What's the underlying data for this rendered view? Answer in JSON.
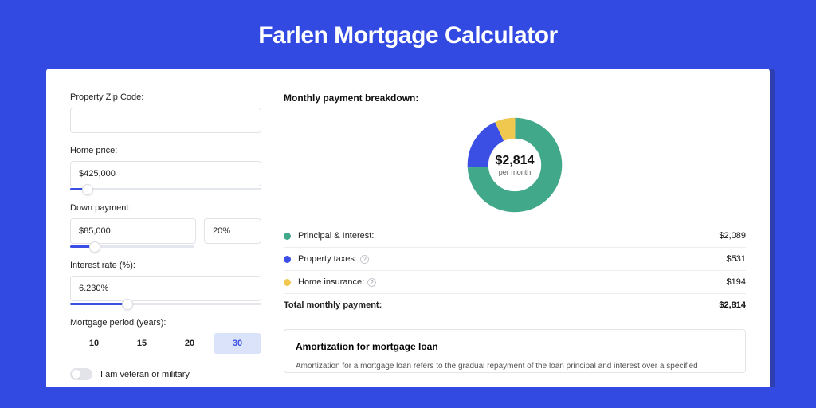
{
  "page_title": "Farlen Mortgage Calculator",
  "form": {
    "zip": {
      "label": "Property Zip Code:",
      "value": ""
    },
    "home_price": {
      "label": "Home price:",
      "value": "$425,000",
      "slider_pct": 9
    },
    "down_payment": {
      "label": "Down payment:",
      "amount": "$85,000",
      "percent": "20%",
      "slider_pct": 20
    },
    "interest_rate": {
      "label": "Interest rate (%):",
      "value": "6.230%",
      "slider_pct": 30
    },
    "period": {
      "label": "Mortgage period (years):",
      "options": [
        "10",
        "15",
        "20",
        "30"
      ],
      "selected": "30"
    },
    "veteran": {
      "label": "I am veteran or military",
      "on": false
    }
  },
  "breakdown": {
    "title": "Monthly payment breakdown:",
    "donut": {
      "amount": "$2,814",
      "sub": "per month"
    },
    "rows": [
      {
        "key": "principal_interest",
        "label": "Principal & Interest:",
        "value": "$2,089",
        "color": "#41a98a",
        "help": false,
        "pct": 74
      },
      {
        "key": "property_taxes",
        "label": "Property taxes:",
        "value": "$531",
        "color": "#3b4fe4",
        "help": true,
        "pct": 19
      },
      {
        "key": "home_insurance",
        "label": "Home insurance:",
        "value": "$194",
        "color": "#f0c850",
        "help": true,
        "pct": 7
      }
    ],
    "total": {
      "label": "Total monthly payment:",
      "value": "$2,814"
    }
  },
  "amortization": {
    "title": "Amortization for mortgage loan",
    "text": "Amortization for a mortgage loan refers to the gradual repayment of the loan principal and interest over a specified"
  },
  "chart_data": {
    "type": "pie",
    "title": "Monthly payment breakdown",
    "categories": [
      "Principal & Interest",
      "Property taxes",
      "Home insurance"
    ],
    "values": [
      2089,
      531,
      194
    ],
    "colors": [
      "#41a98a",
      "#3b4fe4",
      "#f0c850"
    ],
    "total_label": "$2,814 per month"
  }
}
